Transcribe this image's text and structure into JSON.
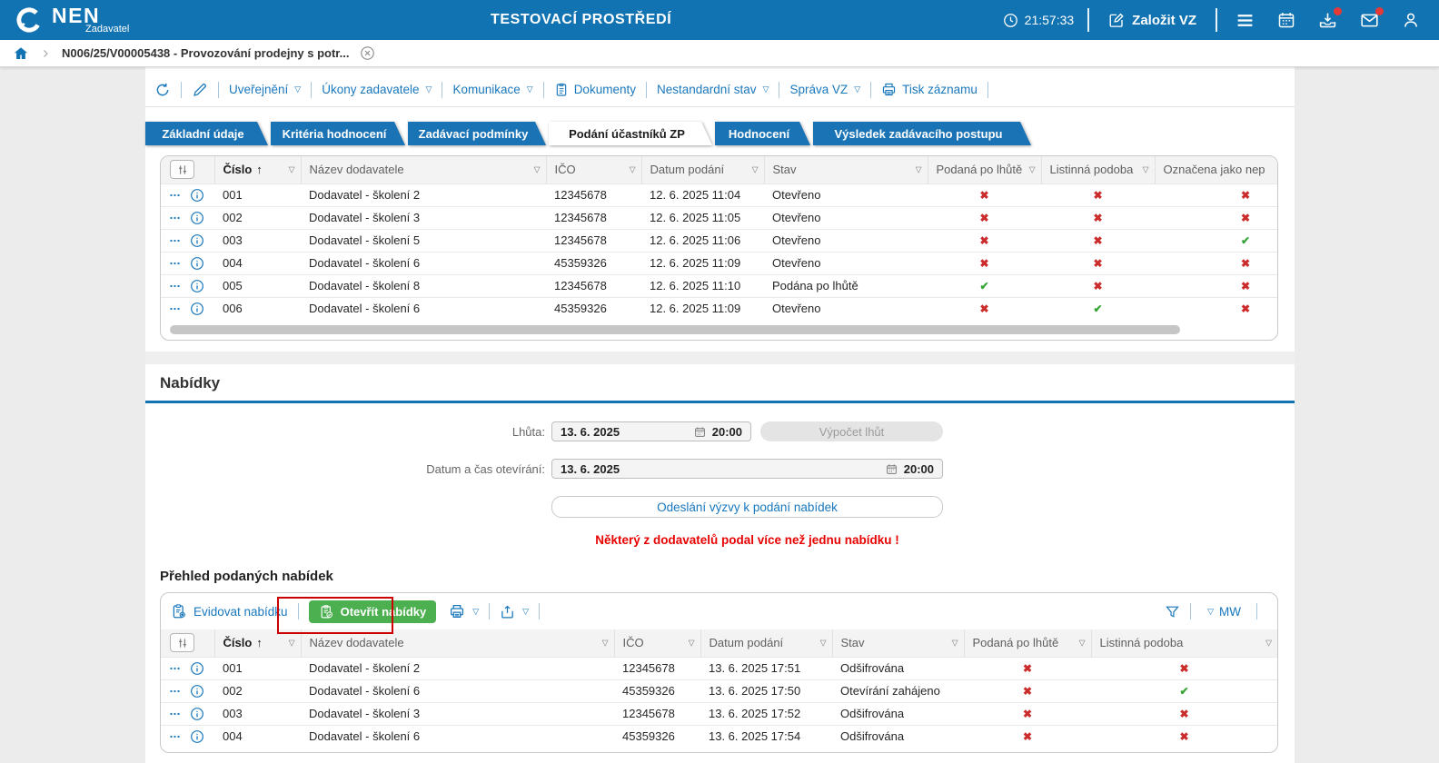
{
  "icons": {
    "check": "✔",
    "cross": "✖",
    "sortAsc": "↑",
    "dropdown": "▽"
  },
  "colors": {
    "headerBlue": "#1273b2",
    "tabBlue": "#1a73b5",
    "linkBlue": "#1a78bd",
    "green": "#4caf50",
    "crossRed": "#cc2b2b",
    "checkGreen": "#35a435",
    "warningRed": "#e80000",
    "annotationRed": "#cc0000"
  },
  "header": {
    "logo": "NEN",
    "logoSub": "Zadavatel",
    "envTitle": "TESTOVACÍ PROSTŘEDÍ",
    "clock": "21:57:33",
    "createVz": "Založit VZ"
  },
  "breadcrumb": {
    "item": "N006/25/V00005438 - Provozování prodejny s potr..."
  },
  "toolbar": {
    "uverejneni": "Uveřejnění",
    "ukony": "Úkony zadavatele",
    "komunikace": "Komunikace",
    "dokumenty": "Dokumenty",
    "nestandardni": "Nestandardní stav",
    "sprava": "Správa VZ",
    "tisk": "Tisk záznamu"
  },
  "tabs": [
    {
      "label": "Základní údaje",
      "active": false
    },
    {
      "label": "Kritéria hodnocení",
      "active": false
    },
    {
      "label": "Zadávací podmínky",
      "active": false
    },
    {
      "label": "Podání účastníků ZP",
      "active": true
    },
    {
      "label": "Hodnocení",
      "active": false
    },
    {
      "label": "Výsledek zadávacího postupu",
      "active": false
    }
  ],
  "table1": {
    "columns": [
      "Číslo",
      "Název dodavatele",
      "IČO",
      "Datum podání",
      "Stav",
      "Podaná po lhůtě",
      "Listinná podoba",
      "Označena jako nep"
    ],
    "rows": [
      {
        "cislo": "001",
        "nazev": "Dodavatel - školení 2",
        "ico": "12345678",
        "datum": "12. 6. 2025 11:04",
        "stav": "Otevřeno",
        "flags": [
          false,
          false,
          false
        ]
      },
      {
        "cislo": "002",
        "nazev": "Dodavatel - školení 3",
        "ico": "12345678",
        "datum": "12. 6. 2025 11:05",
        "stav": "Otevřeno",
        "flags": [
          false,
          false,
          false
        ]
      },
      {
        "cislo": "003",
        "nazev": "Dodavatel - školení 5",
        "ico": "12345678",
        "datum": "12. 6. 2025 11:06",
        "stav": "Otevřeno",
        "flags": [
          false,
          false,
          true
        ]
      },
      {
        "cislo": "004",
        "nazev": "Dodavatel - školení 6",
        "ico": "45359326",
        "datum": "12. 6. 2025 11:09",
        "stav": "Otevřeno",
        "flags": [
          false,
          false,
          false
        ]
      },
      {
        "cislo": "005",
        "nazev": "Dodavatel - školení 8",
        "ico": "12345678",
        "datum": "12. 6. 2025 11:10",
        "stav": "Podána po lhůtě",
        "flags": [
          true,
          false,
          false
        ]
      },
      {
        "cislo": "006",
        "nazev": "Dodavatel - školení 6",
        "ico": "45359326",
        "datum": "12. 6. 2025 11:09",
        "stav": "Otevřeno",
        "flags": [
          false,
          true,
          false
        ]
      }
    ]
  },
  "offers": {
    "sectionTitle": "Nabídky",
    "deadlineLabel": "Lhůta:",
    "deadlineDate": "13. 6. 2025",
    "deadlineTime": "20:00",
    "calcButton": "Výpočet lhůt",
    "openingLabel": "Datum a čas otevírání:",
    "openingDate": "13. 6. 2025",
    "openingTime": "20:00",
    "sendButton": "Odeslání výzvy k podání nabídek",
    "warning": "Některý z dodavatelů podal více než jednu nabídku !"
  },
  "submitted": {
    "title": "Přehled podaných nabídek",
    "registerButton": "Evidovat nabídku",
    "openButton": "Otevřít nabídky",
    "mwLabel": "MW",
    "table": {
      "columns": [
        "Číslo",
        "Název dodavatele",
        "IČO",
        "Datum podání",
        "Stav",
        "Podaná po lhůtě",
        "Listinná podoba"
      ],
      "rows": [
        {
          "cislo": "001",
          "nazev": "Dodavatel - školení 2",
          "ico": "12345678",
          "datum": "13. 6. 2025 17:51",
          "stav": "Odšifrována",
          "flags": [
            false,
            false
          ]
        },
        {
          "cislo": "002",
          "nazev": "Dodavatel - školení 6",
          "ico": "45359326",
          "datum": "13. 6. 2025 17:50",
          "stav": "Otevírání zahájeno",
          "flags": [
            false,
            true
          ]
        },
        {
          "cislo": "003",
          "nazev": "Dodavatel - školení 3",
          "ico": "12345678",
          "datum": "13. 6. 2025 17:52",
          "stav": "Odšifrována",
          "flags": [
            false,
            false
          ]
        },
        {
          "cislo": "004",
          "nazev": "Dodavatel - školení 6",
          "ico": "45359326",
          "datum": "13. 6. 2025 17:54",
          "stav": "Odšifrována",
          "flags": [
            false,
            false
          ]
        }
      ]
    }
  }
}
